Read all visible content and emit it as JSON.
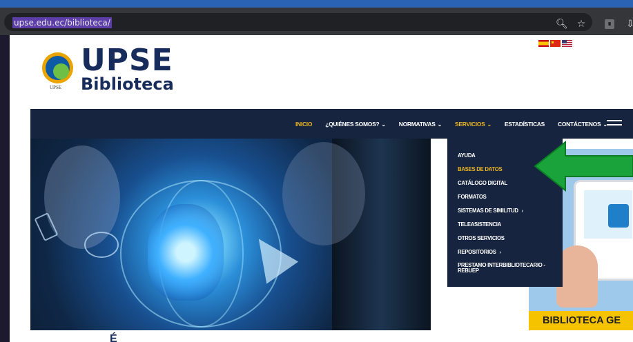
{
  "browser": {
    "url": "upse.edu.ec/biblioteca/",
    "icons": [
      "zoom-icon",
      "star-icon",
      "rss-icon",
      "extension-icon"
    ]
  },
  "site": {
    "logo_title": "UPSE",
    "logo_subtitle": "Biblioteca",
    "seal_caption": "UPSE",
    "flags": [
      "es",
      "cn",
      "us"
    ]
  },
  "nav": {
    "items": [
      {
        "label": "INICIO",
        "state": "active"
      },
      {
        "label": "¿QUIÉNES SOMOS?",
        "dropdown": true
      },
      {
        "label": "NORMATIVAS",
        "dropdown": true
      },
      {
        "label": "SERVICIOS",
        "dropdown": true,
        "state": "open"
      },
      {
        "label": "ESTADÍSTICAS"
      },
      {
        "label": "CONTÁCTENOS",
        "dropdown": true
      }
    ]
  },
  "dropdown": {
    "items": [
      {
        "label": "AYUDA"
      },
      {
        "label": "BASES DE DATOS",
        "highlight": true
      },
      {
        "label": "CATÁLOGO DIGITAL"
      },
      {
        "label": "FORMATOS"
      },
      {
        "label": "SISTEMAS DE SIMILITUD",
        "submenu": true
      },
      {
        "label": "TELEASISTENCIA"
      },
      {
        "label": "OTROS SERVICIOS"
      },
      {
        "label": "REPOSITORIOS",
        "submenu": true
      },
      {
        "label": "PRESTAMO INTERBIBLIOTECARIO -",
        "label2": "REBUEP"
      }
    ]
  },
  "side_banner": {
    "label": "BIBLIOTECA GE"
  },
  "bottom": {
    "title": "É"
  },
  "colors": {
    "nav_bg": "#16243f",
    "accent": "#e9b422",
    "arrow": "#19a33a",
    "logo_text": "#172c5a"
  }
}
